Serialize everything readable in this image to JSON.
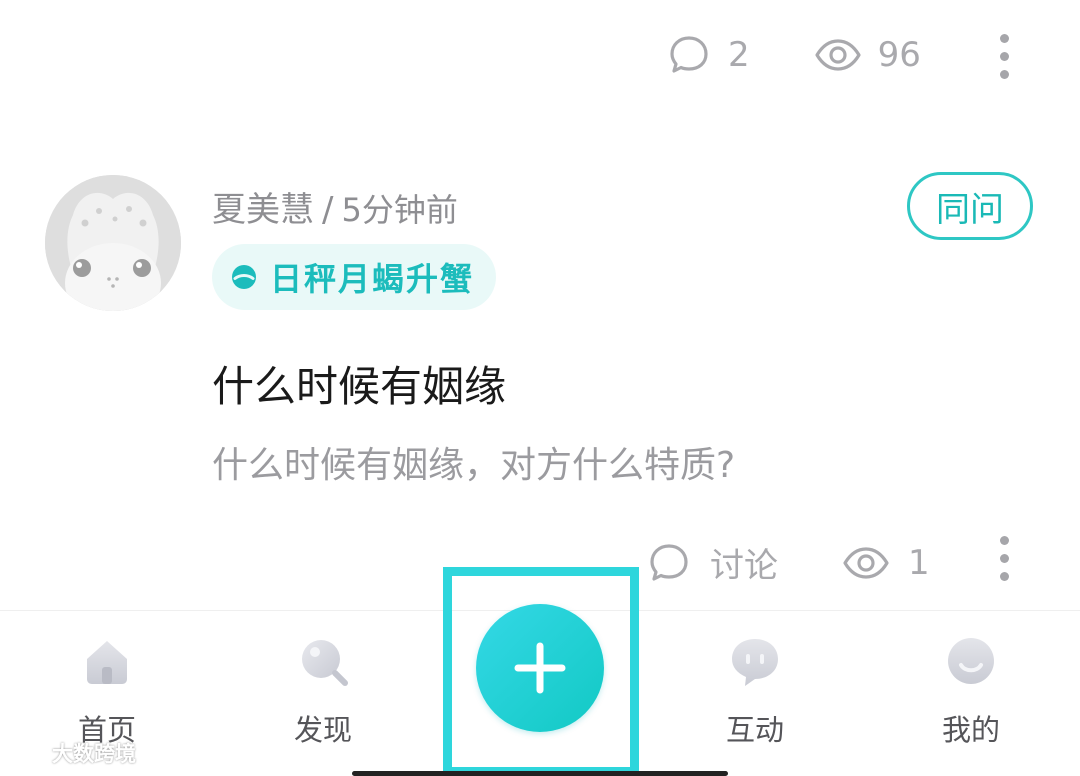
{
  "prev_post": {
    "comment_count": "2",
    "view_count": "96"
  },
  "post": {
    "username": "夏美慧",
    "separator": "/",
    "time_ago": "5分钟前",
    "tag": "日秤月蝎升蟹",
    "same_ask_label": "同问",
    "title": "什么时候有姻缘",
    "body": "什么时候有姻缘，对方什么特质?",
    "discuss_label": "讨论",
    "view_count": "1"
  },
  "tabbar": {
    "items": [
      {
        "label": "首页",
        "icon": "home-icon"
      },
      {
        "label": "发现",
        "icon": "discover-icon"
      },
      {
        "label": "互动",
        "icon": "chat-icon"
      },
      {
        "label": "我的",
        "icon": "profile-icon"
      }
    ],
    "fab_icon": "plus-icon"
  },
  "watermark": {
    "text": "大数跨境"
  },
  "colors": {
    "accent": "#1ab9b6",
    "fab": "#1fd0d4",
    "highlight_frame": "#2ed6dc",
    "muted_text": "#9b9b9f"
  }
}
